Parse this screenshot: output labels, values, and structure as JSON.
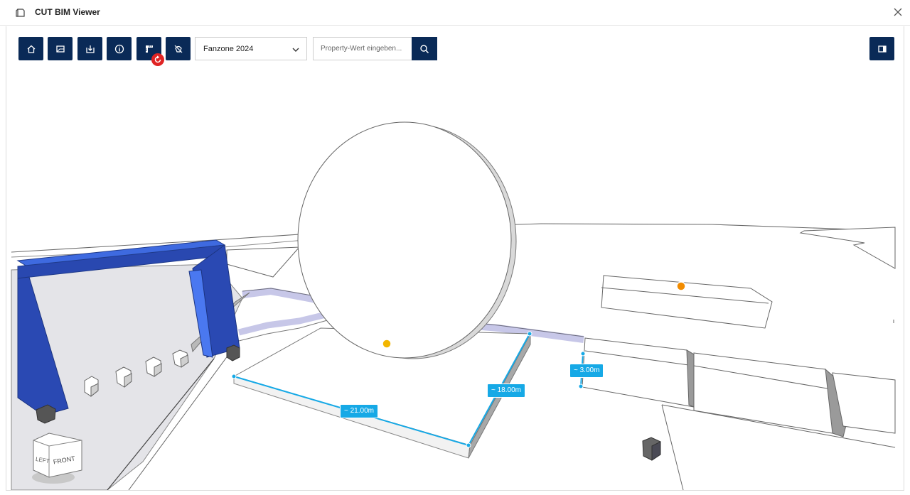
{
  "app": {
    "title": "CUT BIM Viewer",
    "title_icon": "viewer-icon",
    "close_icon": "close-icon"
  },
  "toolbar": {
    "buttons": [
      {
        "name": "home-button",
        "icon": "home-icon"
      },
      {
        "name": "section-button",
        "icon": "section-box-icon"
      },
      {
        "name": "export-button",
        "icon": "download-icon"
      },
      {
        "name": "info-button",
        "icon": "info-icon"
      },
      {
        "name": "measure-button",
        "icon": "measure-icon"
      },
      {
        "name": "hide-button",
        "icon": "eye-off-icon"
      }
    ],
    "measure_badge_icon": "reset-icon",
    "model_select": {
      "value": "Fanzone 2024"
    },
    "search": {
      "placeholder": "Property-Wert eingeben...",
      "value": ""
    },
    "search_icon": "search-icon",
    "panel_toggle_icon": "panel-toggle-icon"
  },
  "measurements": [
    {
      "label": "~ 21.00m"
    },
    {
      "label": "~ 18.00m"
    },
    {
      "label": "~ 3.00m"
    }
  ],
  "viewcube": {
    "faces": [
      "LEFT",
      "FRONT"
    ]
  },
  "colors": {
    "toolbar": "#0a2a57",
    "accent": "#16a9e6",
    "badge": "#e02424",
    "arch": "#2a4fb5",
    "marker_orange": "#f28c00",
    "marker_yellow": "#f2b600"
  }
}
